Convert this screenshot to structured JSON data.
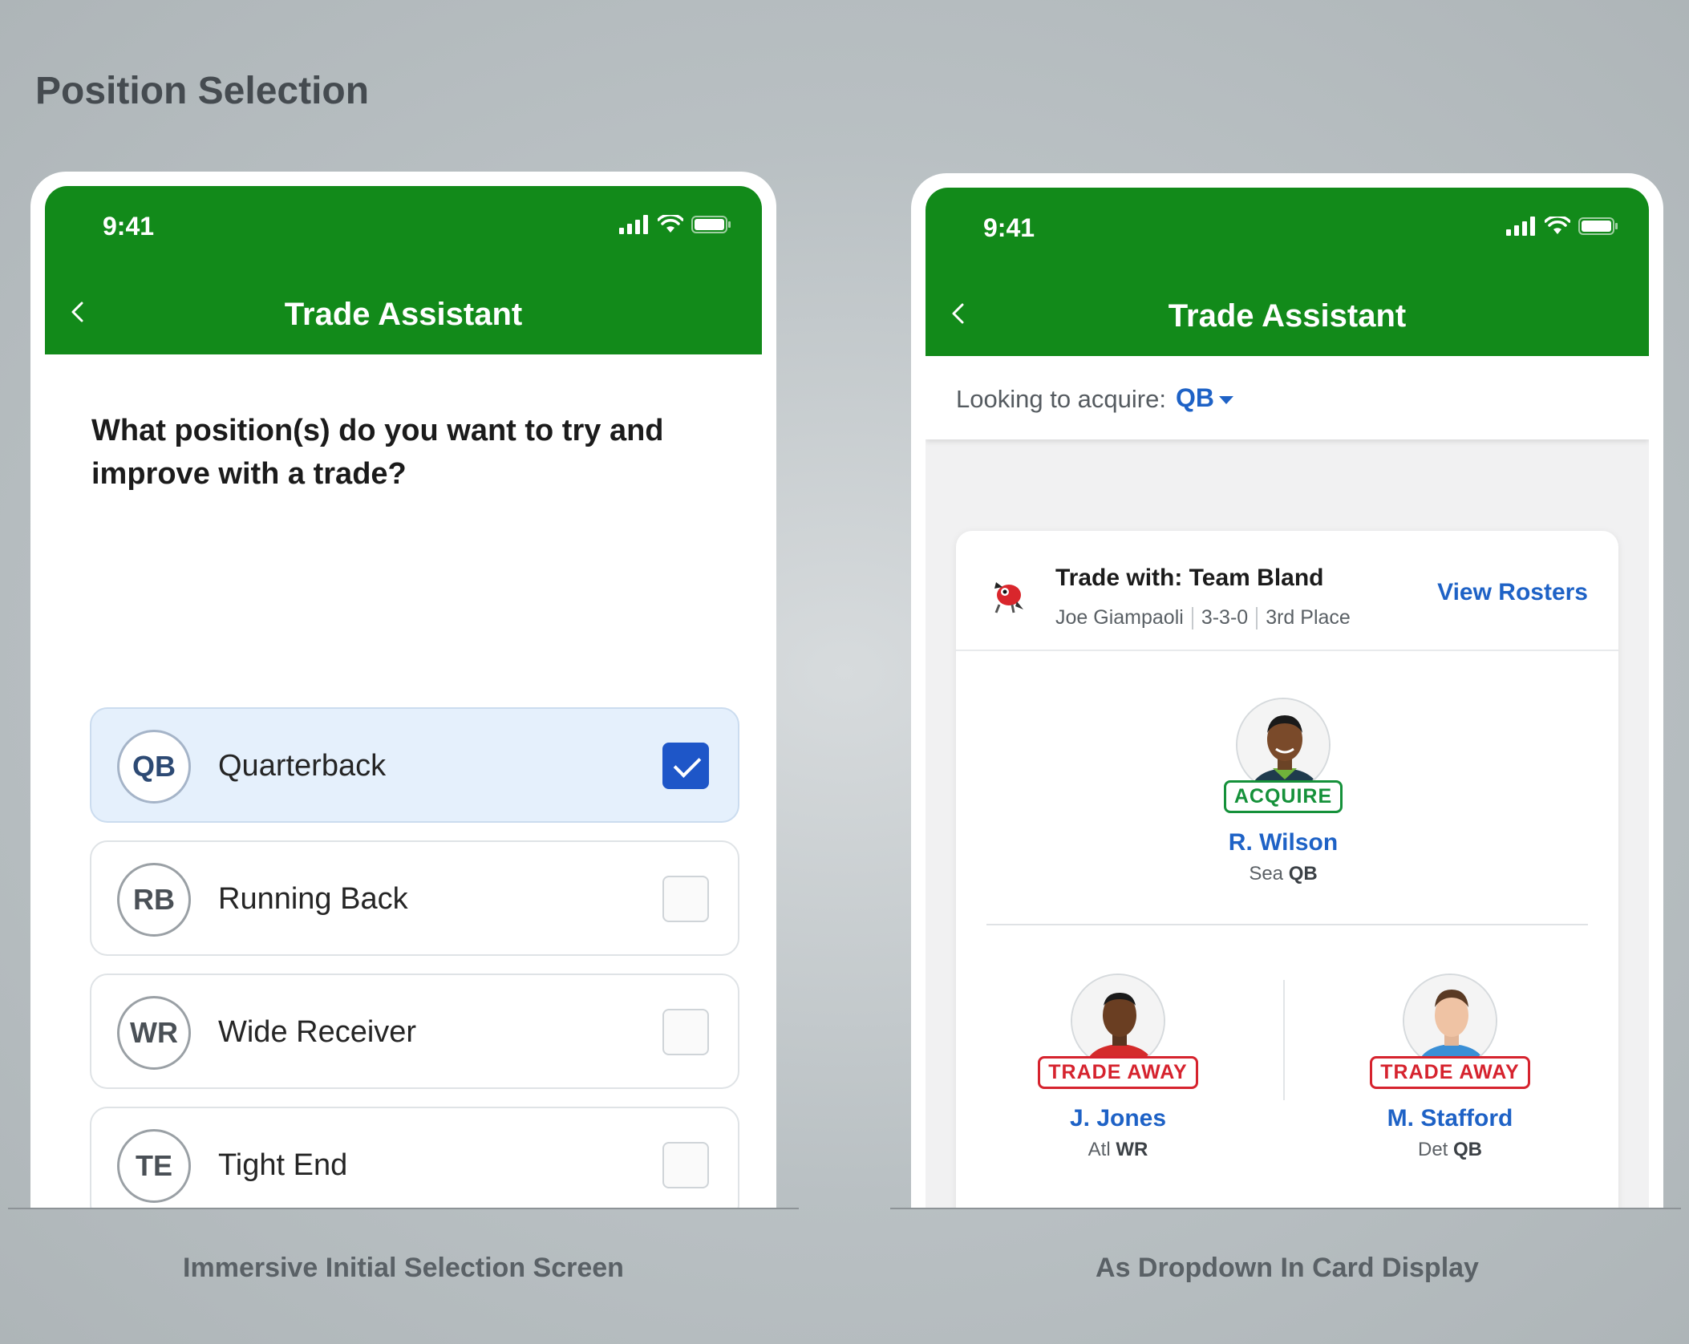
{
  "page": {
    "heading": "Position Selection"
  },
  "captions": {
    "left": "Immersive Initial Selection Screen",
    "right": "As Dropdown In Card Display"
  },
  "phone_left": {
    "status": {
      "time": "9:41"
    },
    "header": {
      "title": "Trade Assistant"
    },
    "question": "What position(s) do you want to try and improve with a trade?",
    "options": [
      {
        "abbr": "QB",
        "label": "Quarterback",
        "checked": true
      },
      {
        "abbr": "RB",
        "label": "Running Back",
        "checked": false
      },
      {
        "abbr": "WR",
        "label": "Wide Receiver",
        "checked": false
      },
      {
        "abbr": "TE",
        "label": "Tight End",
        "checked": false
      }
    ]
  },
  "phone_right": {
    "status": {
      "time": "9:41"
    },
    "header": {
      "title": "Trade Assistant"
    },
    "acquire": {
      "label": "Looking to acquire:",
      "value": "QB"
    },
    "card": {
      "trade_with": "Trade with: Team Bland",
      "owner": "Joe Giampaoli",
      "record": "3-3-0",
      "place": "3rd Place",
      "view_rosters": "View Rosters",
      "acquire_player": {
        "tag": "ACQUIRE",
        "name": "R. Wilson",
        "team": "Sea",
        "pos": "QB"
      },
      "away_players": [
        {
          "tag": "TRADE AWAY",
          "name": "J. Jones",
          "team": "Atl",
          "pos": "WR"
        },
        {
          "tag": "TRADE AWAY",
          "name": "M. Stafford",
          "team": "Det",
          "pos": "QB"
        }
      ]
    }
  },
  "colors": {
    "header_green": "#128a1a",
    "link_blue": "#1e62c6",
    "acquire_green": "#15913a",
    "away_red": "#d6232e",
    "check_blue": "#1e56c8"
  }
}
